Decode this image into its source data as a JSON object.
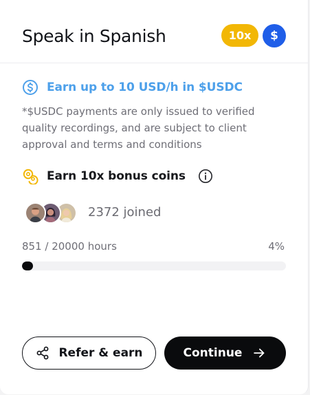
{
  "card": {
    "title": "Speak in Spanish",
    "badges": {
      "multiplier": "10x",
      "currency_symbol": "$"
    },
    "earn": {
      "icon": "dollar-circle-icon",
      "text": "Earn up to 10 USD/h in $USDC",
      "note": "*$USDC payments are only issued to verified\nquality recordings, and are subject to client\napproval and terms and conditions"
    },
    "bonus": {
      "icon": "coins-icon",
      "text": "Earn 10x bonus coins",
      "info_icon": "info-icon"
    },
    "participants": {
      "avatars": [
        "avatar-man",
        "avatar-woman-dark",
        "avatar-woman-blonde"
      ],
      "joined_text": "2372 joined"
    },
    "progress": {
      "hours_text": "851 / 20000 hours",
      "percent_text": "4%",
      "fraction": 0.04255
    },
    "actions": {
      "refer_label": "Refer & earn",
      "refer_icon": "share-icon",
      "continue_label": "Continue",
      "continue_icon": "arrow-right-icon"
    }
  },
  "colors": {
    "accent_blue": "#4da0ea",
    "badge_yellow": "#f2b705",
    "badge_blue": "#1f5ee8",
    "coins_yellow": "#f2b705",
    "button_dark": "#0a0b0d",
    "progress_track": "#f2f2f4"
  }
}
